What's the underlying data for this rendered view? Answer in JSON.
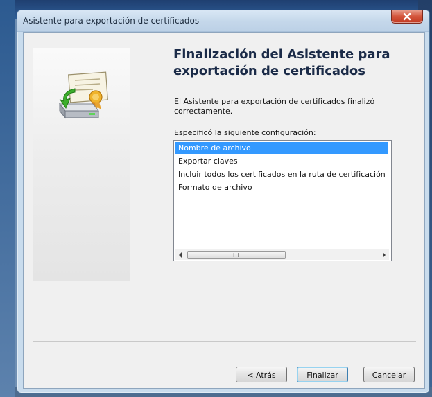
{
  "window": {
    "title": "Asistente para exportación de certificados"
  },
  "wizard": {
    "heading": "Finalización del Asistente para exportación de certificados",
    "description": "El Asistente para exportación de certificados finalizó correctamente.",
    "settings_label": "Especificó la siguiente configuración:",
    "settings": [
      "Nombre de archivo",
      "Exportar claves",
      "Incluir todos los certificados en la ruta de certificación",
      "Formato de archivo"
    ],
    "selected_index": 0,
    "scroll_thumb_label": "III"
  },
  "buttons": {
    "back": "< Atrás",
    "finish": "Finalizar",
    "cancel": "Cancelar"
  },
  "icons": {
    "close": "close-icon",
    "wizard_art": "certificate-export-icon",
    "scroll_left": "scroll-left-arrow-icon",
    "scroll_right": "scroll-right-arrow-icon"
  },
  "colors": {
    "selection": "#3399ff",
    "heading": "#1b2b48",
    "close_button": "#c9442c"
  }
}
